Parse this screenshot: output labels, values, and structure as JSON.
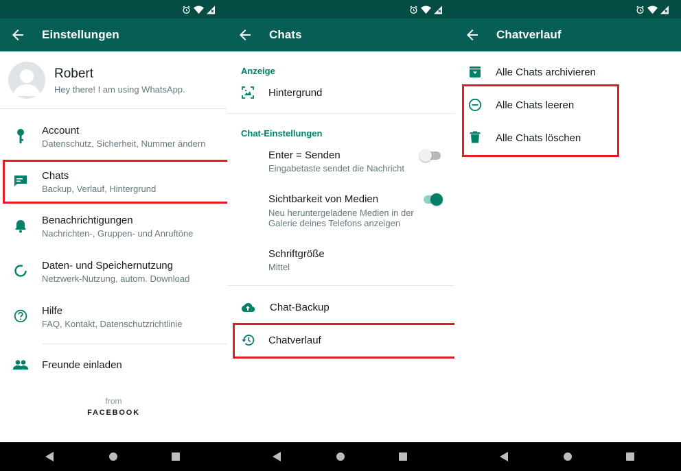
{
  "colors": {
    "accent": "#008069",
    "appbar": "#075e54",
    "statusbar": "#054d44",
    "icon_gray": "#8696a0",
    "highlight": "#e21c23"
  },
  "panels": [
    {
      "title": "Einstellungen",
      "profile": {
        "name": "Robert",
        "status": "Hey there! I am using WhatsApp."
      },
      "items": [
        {
          "icon": "key-icon",
          "title": "Account",
          "subtitle": "Datenschutz, Sicherheit, Nummer ändern"
        },
        {
          "icon": "chat-icon",
          "title": "Chats",
          "subtitle": "Backup, Verlauf, Hintergrund"
        },
        {
          "icon": "bell-icon",
          "title": "Benachrichtigungen",
          "subtitle": "Nachrichten-, Gruppen- und Anruftöne"
        },
        {
          "icon": "data-usage-icon",
          "title": "Daten- und Speichernutzung",
          "subtitle": "Netzwerk-Nutzung, autom. Download"
        },
        {
          "icon": "help-icon",
          "title": "Hilfe",
          "subtitle": "FAQ, Kontakt, Datenschutzrichtlinie"
        }
      ],
      "invite": {
        "icon": "people-icon",
        "label": "Freunde einladen"
      },
      "footer": {
        "from": "from",
        "brand": "FACEBOOK"
      }
    },
    {
      "title": "Chats",
      "sections": [
        {
          "label": "Anzeige"
        },
        {
          "label": "Chat-Einstellungen"
        }
      ],
      "wallpaper": {
        "icon": "wallpaper-icon",
        "label": "Hintergrund"
      },
      "enter_send": {
        "title": "Enter = Senden",
        "subtitle": "Eingabetaste sendet die Nachricht",
        "enabled": false
      },
      "media_visibility": {
        "title": "Sichtbarkeit von Medien",
        "subtitle_line1": "Neu heruntergeladene Medien in der",
        "subtitle_line2": "Galerie deines Telefons anzeigen",
        "enabled": true
      },
      "font_size": {
        "title": "Schriftgröße",
        "value": "Mittel"
      },
      "backup": {
        "icon": "cloud-upload-icon",
        "label": "Chat-Backup"
      },
      "history": {
        "icon": "history-icon",
        "label": "Chatverlauf"
      }
    },
    {
      "title": "Chatverlauf",
      "items": [
        {
          "icon": "archive-icon",
          "label": "Alle Chats archivieren"
        },
        {
          "icon": "minus-circle-icon",
          "label": "Alle Chats leeren"
        },
        {
          "icon": "trash-icon",
          "label": "Alle Chats löschen"
        }
      ]
    }
  ]
}
